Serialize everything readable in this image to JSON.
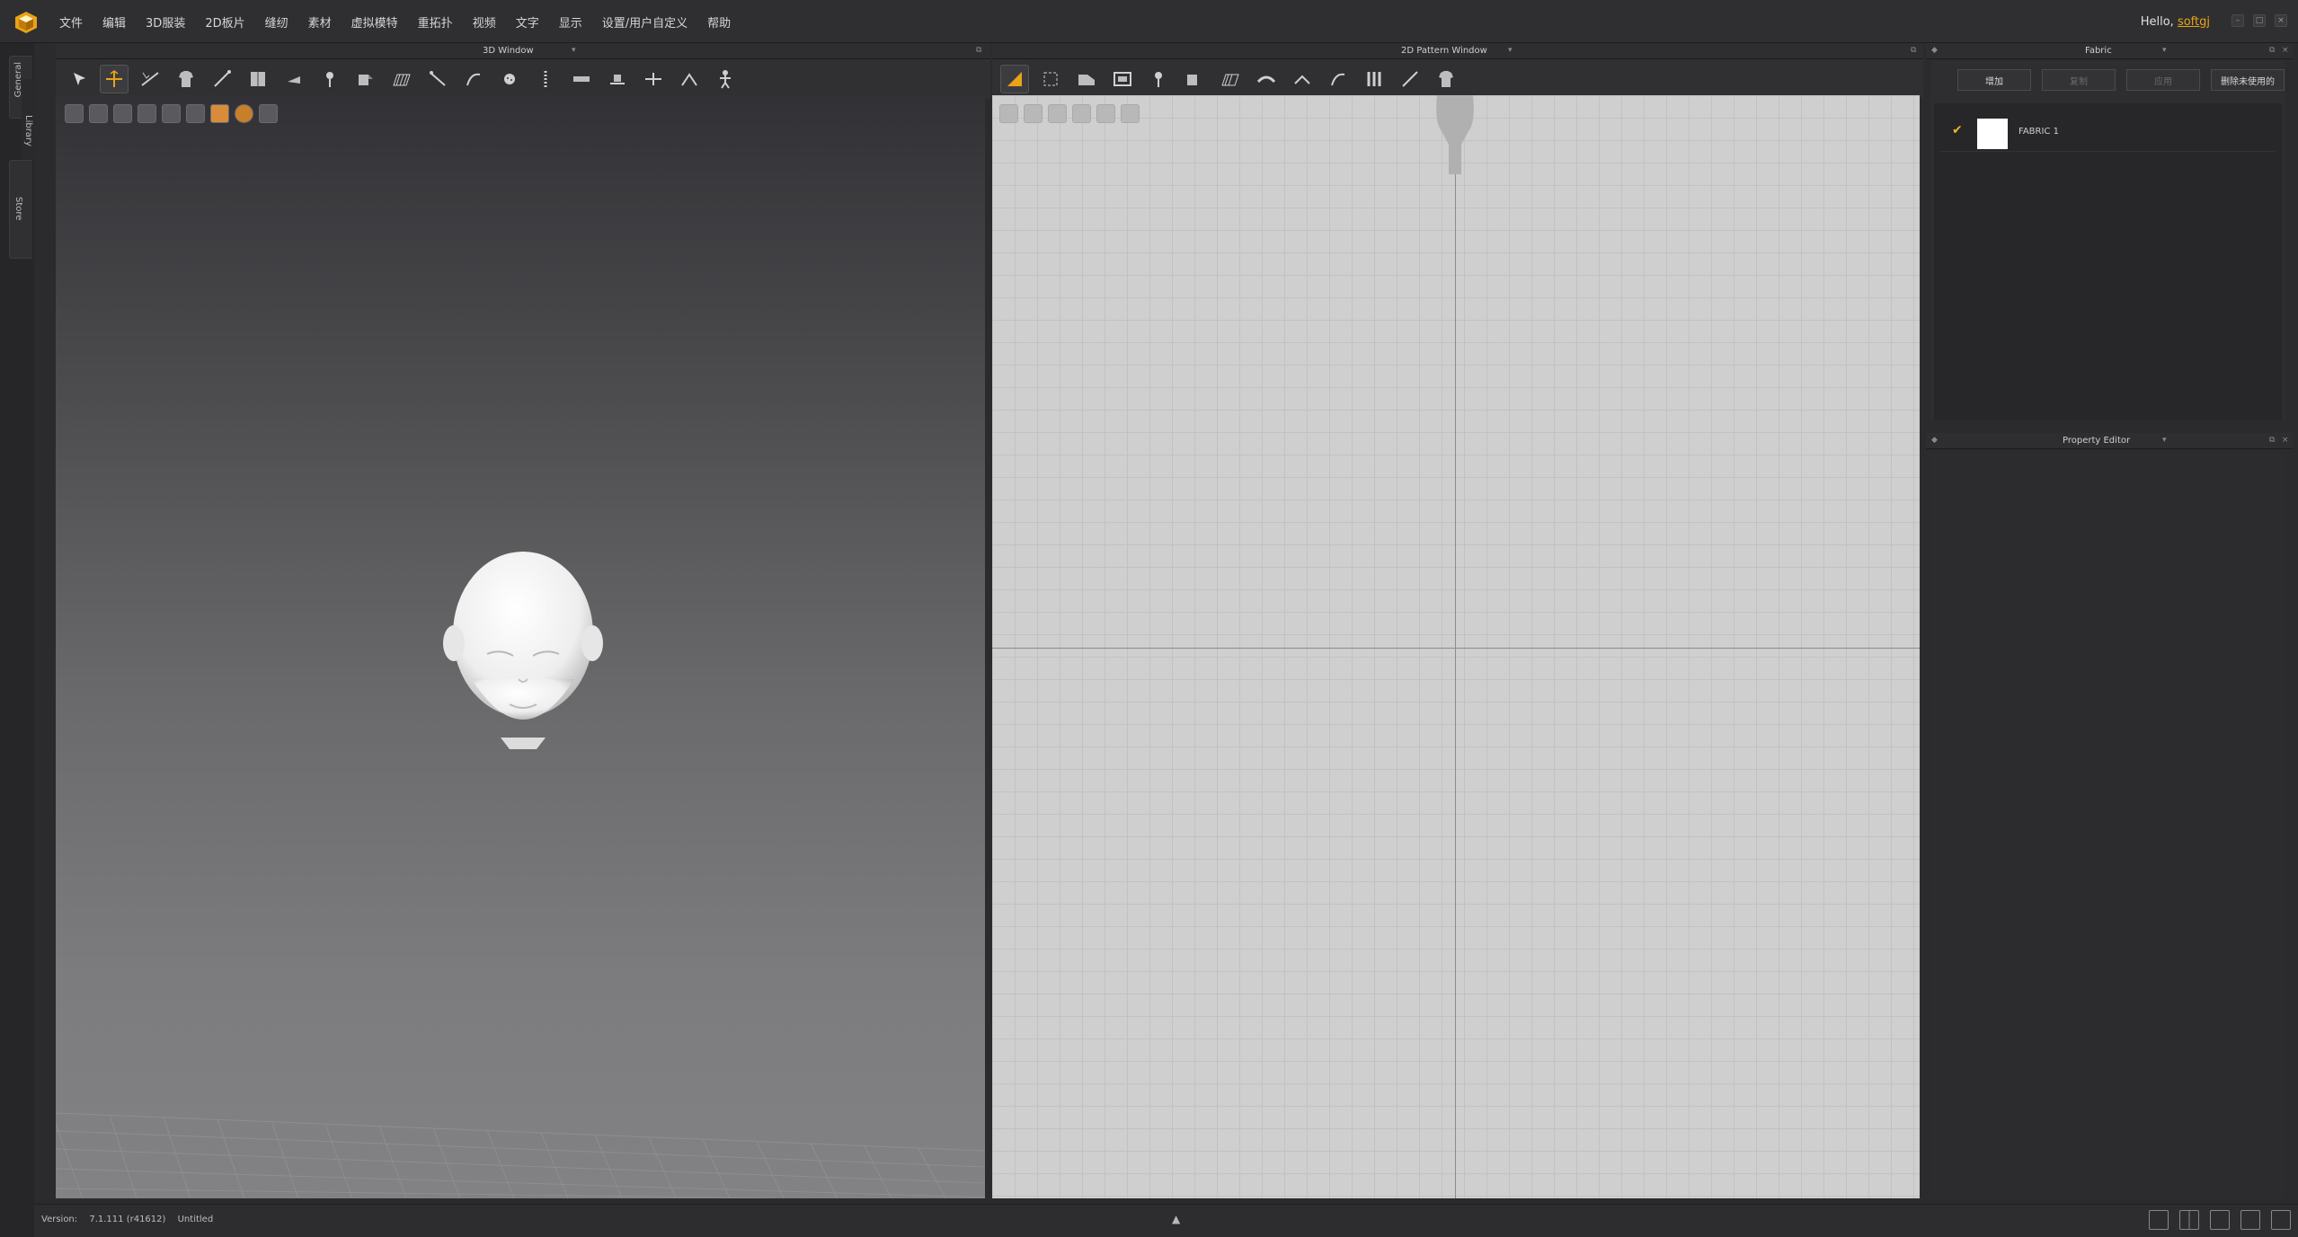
{
  "app": {
    "logo": "clo3d-cube-icon"
  },
  "menu": [
    "文件",
    "编辑",
    "3D服装",
    "2D板片",
    "缝纫",
    "素材",
    "虚拟模特",
    "重拓扑",
    "视频",
    "文字",
    "显示",
    "设置/用户自定义",
    "帮助"
  ],
  "user": {
    "greeting": "Hello,",
    "name": "softgj"
  },
  "side_tabs": [
    "General",
    "Library",
    "Store"
  ],
  "window3d": {
    "title": "3D Window"
  },
  "window2d": {
    "title": "2D Pattern Window"
  },
  "fabric_panel": {
    "title": "Fabric",
    "buttons": [
      {
        "label": "增加",
        "enabled": true
      },
      {
        "label": "复制",
        "enabled": false
      },
      {
        "label": "应用",
        "enabled": false
      },
      {
        "label": "删除未使用的",
        "enabled": true
      }
    ],
    "items": [
      {
        "name": "FABRIC 1",
        "checked": true,
        "color": "#ffffff"
      }
    ]
  },
  "property_editor": {
    "title": "Property Editor"
  },
  "status": {
    "version_label": "Version:",
    "version": "7.1.111 (r41612)",
    "file": "Untitled"
  },
  "colors": {
    "accent": "#e8a317",
    "bg": "#2b2b2d"
  }
}
